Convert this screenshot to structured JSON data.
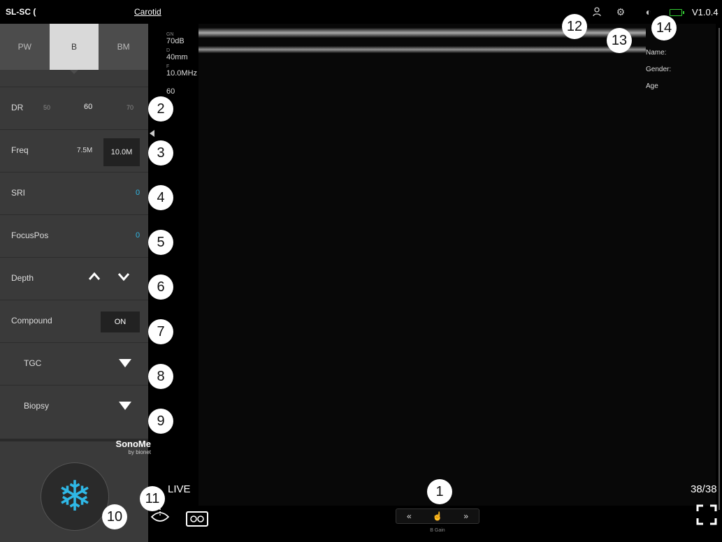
{
  "topbar": {
    "probe": "SL-SC (",
    "preset": "Carotid",
    "version": "V1.0.4"
  },
  "modes": [
    "PW",
    "B",
    "BM"
  ],
  "controls": {
    "dr": {
      "label": "DR",
      "options": [
        "50",
        "60",
        "70"
      ],
      "selected": "60"
    },
    "freq": {
      "label": "Freq",
      "options": [
        "7.5M",
        "10.0M"
      ],
      "selected": "10.0M"
    },
    "sri": {
      "label": "SRI",
      "value": "0"
    },
    "focus": {
      "label": "FocusPos",
      "value": "0"
    },
    "depth": {
      "label": "Depth"
    },
    "compound": {
      "label": "Compound",
      "value": "ON"
    },
    "tgc": {
      "label": "TGC"
    },
    "biopsy": {
      "label": "Biopsy"
    }
  },
  "params": {
    "gn_key": "GN",
    "gn_val": "70dB",
    "d_key": "D",
    "d_val": "40mm",
    "f_key": "F",
    "f_val": "10.0MHz",
    "dr_val": "60"
  },
  "patient": {
    "name": "Name:",
    "gender": "Gender:",
    "age": "Age"
  },
  "status": {
    "live": "LIVE",
    "frames": "38/38",
    "gain_label": "B Gain"
  },
  "brand": {
    "name": "SonoMe",
    "sub": "by bionet"
  },
  "callouts": [
    "1",
    "2",
    "3",
    "4",
    "5",
    "6",
    "7",
    "8",
    "9",
    "10",
    "11",
    "12",
    "13",
    "14"
  ],
  "colors": {
    "accent": "#2fb8e6",
    "panel": "#3a3a3a",
    "battery": "#33cc33"
  }
}
